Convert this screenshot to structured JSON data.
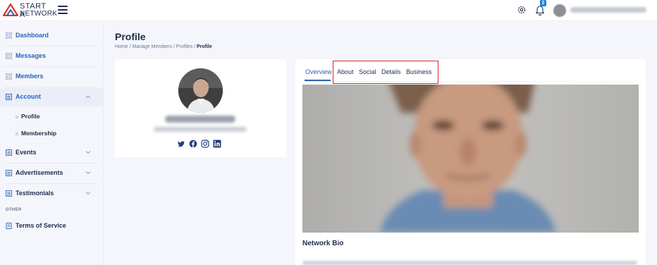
{
  "brand": {
    "line1": "START A",
    "line2": "NETWORK",
    "colors": {
      "red": "#e0312f",
      "navy": "#1f2d4e",
      "blue": "#2a63b8"
    }
  },
  "header": {
    "notification_count": "2",
    "icons": [
      "gear-icon",
      "bell-icon"
    ]
  },
  "sidebar": {
    "items": [
      {
        "label": "Dashboard",
        "icon": "grid-icon"
      },
      {
        "label": "Messages",
        "icon": "grid-icon"
      },
      {
        "label": "Members",
        "icon": "grid-icon"
      },
      {
        "label": "Account",
        "icon": "list-icon",
        "expanded": true,
        "children": [
          {
            "label": "Profile"
          },
          {
            "label": "Membership"
          }
        ]
      },
      {
        "label": "Events",
        "icon": "list-icon"
      },
      {
        "label": "Advertisements",
        "icon": "list-icon"
      },
      {
        "label": "Testimonials",
        "icon": "list-icon"
      }
    ],
    "section_other": "OTHER",
    "other_items": [
      {
        "label": "Terms of Service",
        "icon": "document-icon"
      }
    ]
  },
  "page": {
    "title": "Profile",
    "breadcrumb": [
      "Home",
      "Manage Members",
      "Profiles",
      "Profile"
    ]
  },
  "profile_card": {
    "socials": [
      "twitter-icon",
      "facebook-icon",
      "instagram-icon",
      "linkedin-icon"
    ]
  },
  "tabs": [
    "Overview",
    "About",
    "Social",
    "Details",
    "Business"
  ],
  "active_tab": "Overview",
  "bio": {
    "heading": "Network Bio"
  }
}
